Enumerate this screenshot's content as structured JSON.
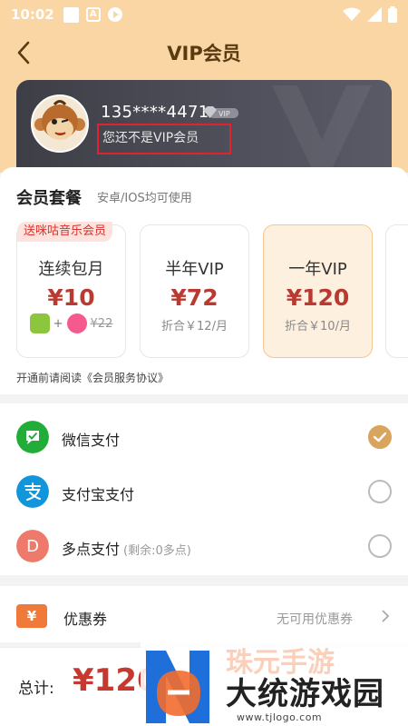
{
  "status_bar": {
    "time": "10:02",
    "a_icon": "A"
  },
  "nav": {
    "title": "VIP会员"
  },
  "user": {
    "phone": "135****4471",
    "vip_tag": "VIP",
    "status": "您还不是VIP会员"
  },
  "packages": {
    "title": "会员套餐",
    "subtitle": "安卓/IOS均可使用",
    "items": [
      {
        "name": "连续包月",
        "price": "¥10",
        "gift_tag": "送咪咕音乐会员",
        "bonus_plus": "+",
        "original": "¥22"
      },
      {
        "name": "半年VIP",
        "price": "¥72",
        "note": "折合￥12/月"
      },
      {
        "name": "一年VIP",
        "price": "¥120",
        "note": "折合￥10/月",
        "selected": true
      }
    ],
    "agreement": "开通前请阅读《会员服务协议》"
  },
  "payment": {
    "methods": [
      {
        "label": "微信支付",
        "icon": "wechat-pay-icon",
        "selected": true
      },
      {
        "label": "支付宝支付",
        "icon": "alipay-icon",
        "selected": false
      },
      {
        "label": "多点支付",
        "icon": "duodian-icon",
        "icon_letter": "D",
        "remain": "(剩余:0多点)",
        "selected": false
      }
    ]
  },
  "coupon": {
    "icon_text": "¥",
    "label": "优惠券",
    "value": "无可用优惠券"
  },
  "footer": {
    "total_label": "总计:",
    "total_price": "¥120"
  },
  "watermark": {
    "text": "大统游戏园",
    "ghost": "珠元手游",
    "url": "www.tjlogo.com"
  },
  "colors": {
    "header": "#f9d6a3",
    "price": "#b83a32",
    "selected_radio": "#d9a45d",
    "card": "#45454f"
  }
}
